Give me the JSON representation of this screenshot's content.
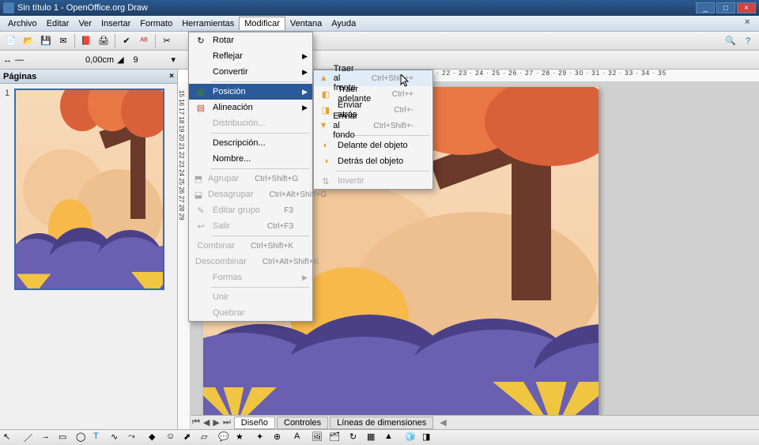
{
  "title": "Sin título 1 - OpenOffice.org Draw",
  "menubar": [
    "Archivo",
    "Editar",
    "Ver",
    "Insertar",
    "Formato",
    "Herramientas",
    "Modificar",
    "Ventana",
    "Ayuda"
  ],
  "activeMenuIndex": 6,
  "toolbar2": {
    "spin": "0,00cm",
    "fill_label": "9"
  },
  "panel": {
    "title": "Páginas",
    "page_num": "1"
  },
  "ruler_h_marks": "7 · 8 · 9 · 10 · 11 · 12 · 13 · 14 · 15 · 16 · 17 · 18 · 19 · 20 · 21 · 22 · 23 · 24 · 25 · 26 · 27 · 28 · 29 · 30 · 31 · 32 · 33 · 34 · 35",
  "ruler_v_marks": "15 16 17 18 19 20 21 22 23 24 25 26 27 28 29",
  "tabs": [
    "Diseño",
    "Controles",
    "Líneas de dimensiones"
  ],
  "modificar_menu": [
    {
      "icon": "↻",
      "label": "Rotar",
      "type": "item"
    },
    {
      "label": "Reflejar",
      "type": "sub"
    },
    {
      "label": "Convertir",
      "type": "sub"
    },
    {
      "type": "sep"
    },
    {
      "icon": "▦",
      "iconcolor": "#3a7a3a",
      "label": "Posición",
      "type": "sub",
      "highlighted": true
    },
    {
      "icon": "▤",
      "iconcolor": "#c05030",
      "label": "Alineación",
      "type": "sub"
    },
    {
      "label": "Distribución...",
      "type": "item",
      "disabled": true
    },
    {
      "type": "sep"
    },
    {
      "label": "Descripción...",
      "type": "item"
    },
    {
      "label": "Nombre...",
      "type": "item"
    },
    {
      "type": "sep"
    },
    {
      "icon": "⬒",
      "label": "Agrupar",
      "shortcut": "Ctrl+Shift+G",
      "type": "item",
      "disabled": true
    },
    {
      "icon": "⬓",
      "label": "Desagrupar",
      "shortcut": "Ctrl+Alt+Shift+G",
      "type": "item",
      "disabled": true
    },
    {
      "icon": "✎",
      "label": "Editar grupo",
      "shortcut": "F3",
      "type": "item",
      "disabled": true
    },
    {
      "icon": "↩",
      "label": "Salir",
      "shortcut": "Ctrl+F3",
      "type": "item",
      "disabled": true
    },
    {
      "type": "sep"
    },
    {
      "label": "Combinar",
      "shortcut": "Ctrl+Shift+K",
      "type": "item",
      "disabled": true
    },
    {
      "label": "Descombinar",
      "shortcut": "Ctrl+Alt+Shift+K",
      "type": "item",
      "disabled": true
    },
    {
      "label": "Formas",
      "type": "sub",
      "disabled": true
    },
    {
      "type": "sep"
    },
    {
      "label": "Unir",
      "type": "item",
      "disabled": true
    },
    {
      "label": "Quebrar",
      "type": "item",
      "disabled": true
    }
  ],
  "posicion_submenu": [
    {
      "icon": "▲",
      "color": "#e8a030",
      "label": "Traer al frente",
      "shortcut": "Ctrl+Shift++",
      "hover": true
    },
    {
      "icon": "◧",
      "color": "#e8a030",
      "label": "Traer adelante",
      "shortcut": "Ctrl++"
    },
    {
      "icon": "◨",
      "color": "#e8a030",
      "label": "Enviar atrás",
      "shortcut": "Ctrl+-"
    },
    {
      "icon": "▼",
      "color": "#e8a030",
      "label": "Enviar al fondo",
      "shortcut": "Ctrl+Shift+-"
    },
    {
      "type": "sep"
    },
    {
      "icon": "◐",
      "color": "#e8a030",
      "label": "Delante del objeto"
    },
    {
      "icon": "◑",
      "color": "#e8a030",
      "label": "Detrás del objeto"
    },
    {
      "type": "sep"
    },
    {
      "icon": "⇅",
      "label": "Invertir",
      "disabled": true
    }
  ]
}
